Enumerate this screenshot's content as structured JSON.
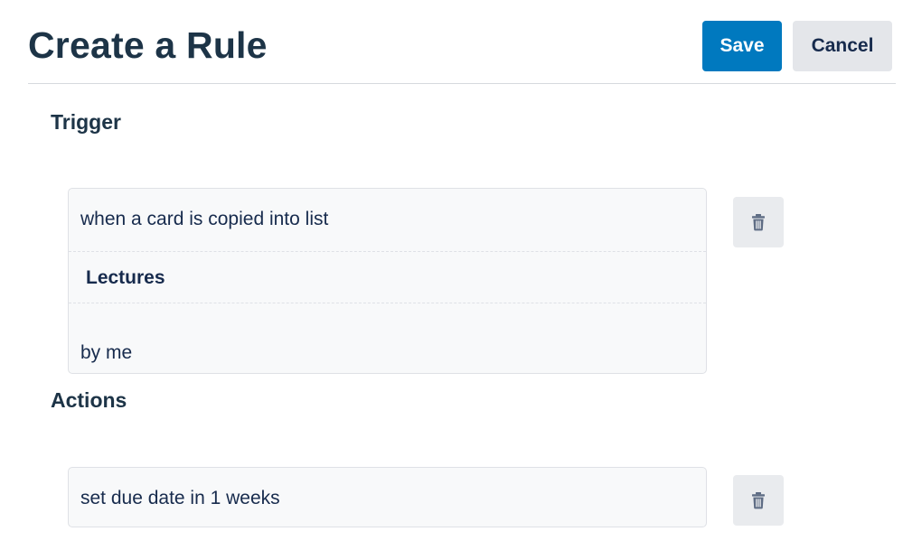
{
  "header": {
    "title": "Create a Rule",
    "save_label": "Save",
    "cancel_label": "Cancel"
  },
  "trigger": {
    "section_title": "Trigger",
    "rows": [
      "when a card is copied into list",
      "Lectures",
      "by me"
    ],
    "delete_icon": "trash-icon"
  },
  "actions": {
    "section_title": "Actions",
    "rows": [
      "set due date in 1 weeks"
    ],
    "delete_icon": "trash-icon"
  },
  "colors": {
    "accent": "#0079bf",
    "text": "#172b4d",
    "title": "#1d3447",
    "card_bg": "#f8f9fa",
    "neutral_button": "#e4e6ea"
  }
}
